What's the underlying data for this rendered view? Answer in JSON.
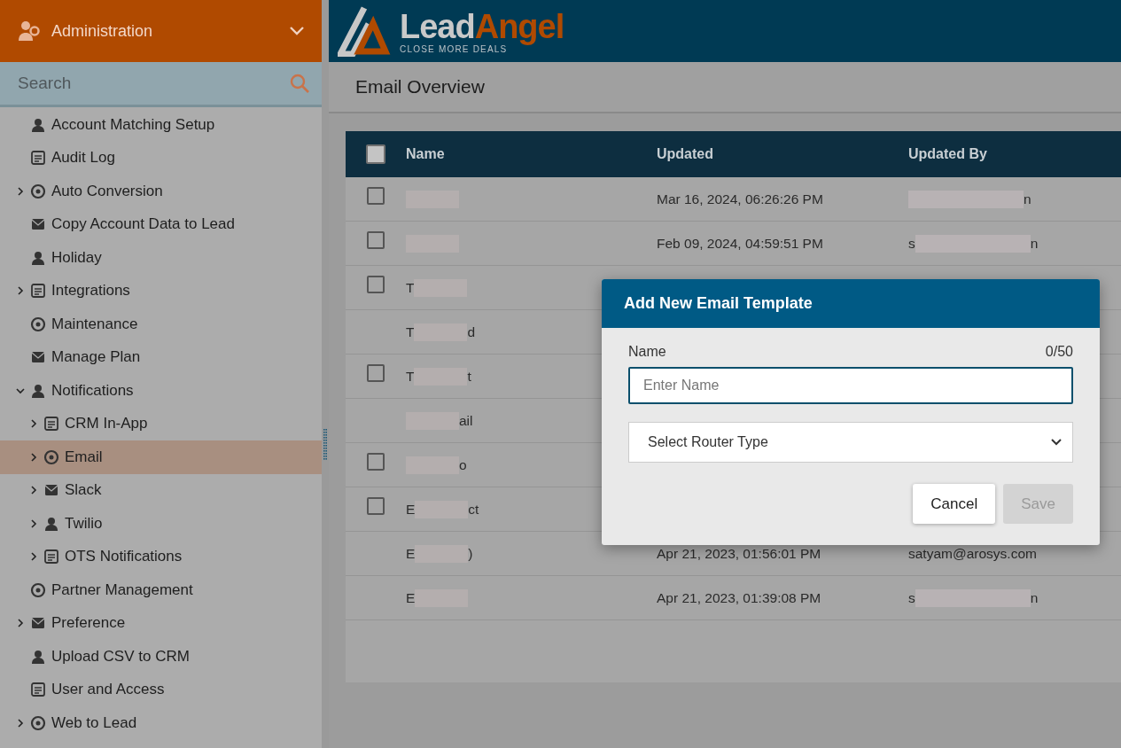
{
  "sidebar": {
    "header": {
      "title": "Administration",
      "expanded": true
    },
    "search": {
      "placeholder": "Search"
    },
    "items": [
      {
        "label": "Account Matching Setup",
        "selected": false
      },
      {
        "label": "Audit Log",
        "selected": false
      },
      {
        "label": "Auto Conversion",
        "expanded": false,
        "selected": false
      },
      {
        "label": "Copy Account Data to Lead",
        "selected": false
      },
      {
        "label": "Holiday",
        "selected": false
      },
      {
        "label": "Integrations",
        "expanded": false,
        "selected": false
      },
      {
        "label": "Maintenance",
        "selected": false
      },
      {
        "label": "Manage Plan",
        "selected": false
      },
      {
        "label": "Notifications",
        "expanded": true,
        "selected": false,
        "children": [
          {
            "label": "CRM In-App",
            "expanded": false,
            "selected": false
          },
          {
            "label": "Email",
            "expanded": false,
            "selected": true
          },
          {
            "label": "Slack",
            "expanded": false,
            "selected": false
          },
          {
            "label": "Twilio",
            "expanded": false,
            "selected": false
          },
          {
            "label": "OTS Notifications",
            "expanded": false,
            "selected": false
          }
        ]
      },
      {
        "label": "Partner Management",
        "selected": false
      },
      {
        "label": "Preference",
        "expanded": false,
        "selected": false
      },
      {
        "label": "Upload CSV to CRM",
        "selected": false
      },
      {
        "label": "User and Access",
        "selected": false
      },
      {
        "label": "Web to Lead",
        "expanded": false,
        "selected": false
      }
    ]
  },
  "logo": {
    "word_1": "Lead",
    "word_2": "Angel",
    "tagline": "CLOSE MORE DEALS"
  },
  "page_title": "Email Overview",
  "table": {
    "select_all": {
      "checked": false
    },
    "columns": [
      "Name",
      "Updated",
      "Updated By"
    ],
    "rows": [
      {
        "checkbox": {
          "checked": false
        },
        "name": [
          {
            "kind": "redacted"
          }
        ],
        "updated": "Mar 16, 2024, 06:26:26 PM",
        "updated_by": [
          {
            "kind": "redacted"
          },
          {
            "kind": "text",
            "text": "n"
          }
        ]
      },
      {
        "checkbox": {
          "checked": false
        },
        "name": [
          {
            "kind": "redacted"
          }
        ],
        "updated": "Feb 09, 2024, 04:59:51 PM",
        "updated_by": [
          {
            "kind": "text",
            "text": "s"
          },
          {
            "kind": "redacted"
          },
          {
            "kind": "text",
            "text": "n"
          }
        ]
      },
      {
        "checkbox": {
          "checked": false
        },
        "name": [
          {
            "kind": "text",
            "text": "T"
          },
          {
            "kind": "redacted"
          }
        ]
      },
      {
        "name": [
          {
            "kind": "text",
            "text": "T"
          },
          {
            "kind": "redacted"
          },
          {
            "kind": "text",
            "text": "d"
          }
        ]
      },
      {
        "checkbox": {
          "checked": false
        },
        "name": [
          {
            "kind": "text",
            "text": "T"
          },
          {
            "kind": "redacted"
          },
          {
            "kind": "text",
            "text": "t"
          }
        ]
      },
      {
        "name": [
          {
            "kind": "redacted"
          },
          {
            "kind": "text",
            "text": "ail"
          }
        ]
      },
      {
        "checkbox": {
          "checked": false
        },
        "name": [
          {
            "kind": "redacted"
          },
          {
            "kind": "text",
            "text": "o"
          }
        ]
      },
      {
        "checkbox": {
          "checked": false
        },
        "name": [
          {
            "kind": "text",
            "text": "E"
          },
          {
            "kind": "redacted"
          },
          {
            "kind": "text",
            "text": "ct"
          }
        ]
      },
      {
        "name": [
          {
            "kind": "text",
            "text": "E"
          },
          {
            "kind": "redacted"
          },
          {
            "kind": "text",
            "text": ")"
          }
        ],
        "updated": "Apr 21, 2023, 01:56:01 PM",
        "updated_by": [
          {
            "kind": "text",
            "text": "satyam@arosys.com"
          }
        ]
      },
      {
        "name": [
          {
            "kind": "text",
            "text": "E"
          },
          {
            "kind": "redacted"
          }
        ],
        "updated": "Apr 21, 2023, 01:39:08 PM",
        "updated_by": [
          {
            "kind": "text",
            "text": "s"
          },
          {
            "kind": "redacted"
          },
          {
            "kind": "text",
            "text": "n"
          }
        ]
      }
    ]
  },
  "dialog": {
    "title": "Add New Email Template",
    "name_label": "Name",
    "counter": "0/50",
    "name_field": {
      "placeholder": "Enter Name"
    },
    "router_select": {
      "value": "Select Router Type"
    },
    "buttons": [
      {
        "label": "Cancel",
        "disabled": false
      },
      {
        "label": "Save",
        "disabled": true
      }
    ]
  }
}
